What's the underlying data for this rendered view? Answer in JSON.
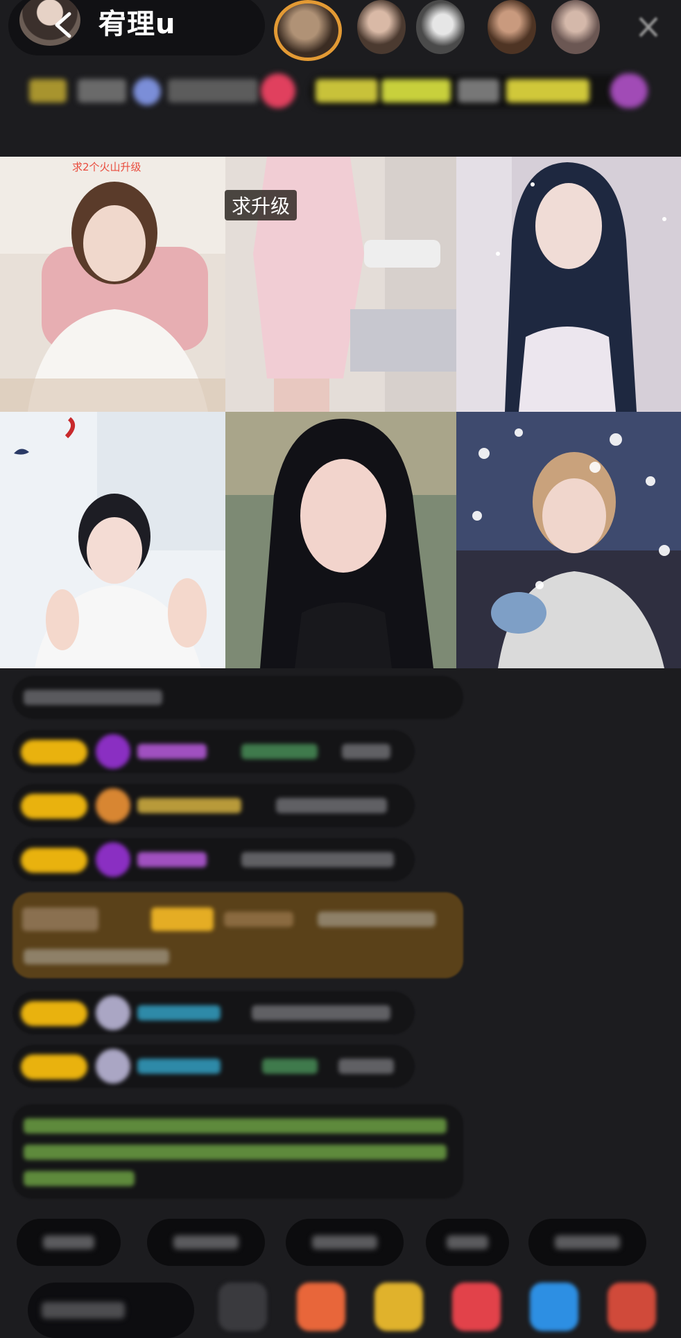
{
  "header": {
    "host_name": "宥理u"
  },
  "video_tags": {
    "cell1": "求2个火山升级",
    "cell2": "求升级"
  },
  "colors": {
    "background": "#1c1c1f",
    "badge_gold": "#e9b20e",
    "tag_red": "#e94b3c"
  }
}
